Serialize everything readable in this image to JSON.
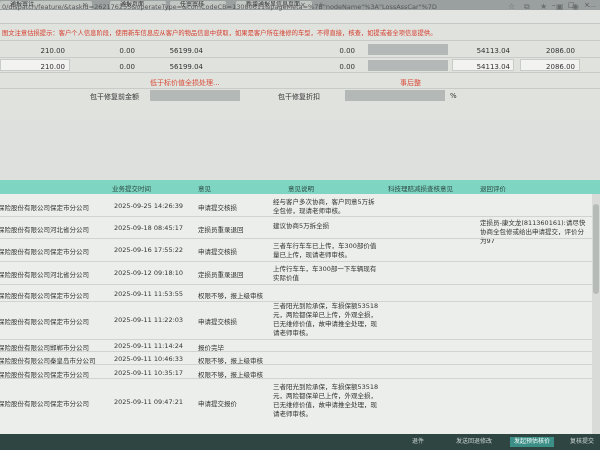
{
  "browser": {
    "tabs": [
      {
        "label": "通报审计"
      },
      {
        "label": "通报页面"
      },
      {
        "label": "任审审核"
      },
      {
        "label": "新增通报显信息页面"
      }
    ],
    "url": "0/dispatch/feature/&taskId=262176255&operateType=&comCodeCB=13080611&pageMeta=%7B\"nodeName\"%3A\"LossAssCar\"%7D"
  },
  "warning": "图文注意估损提示：客户个人信息阶段，使用新车信息应从客户的物品信息中获取，如果是客户所在维修的车型，不得直接，核查，如提或者全项信息提供。",
  "summary": {
    "row1": [
      "210.00",
      "0.00",
      "56199.04",
      "0.00",
      "54113.04",
      "2086.00"
    ],
    "row2": [
      "210.00",
      "0.00",
      "56199.04",
      "0.00",
      "54113.04",
      "2086.00"
    ],
    "link_left": "低于标价值全损处理...",
    "link_right": "事后整",
    "label_left": "包干修复前金额",
    "label_right": "包干修复折扣",
    "pct": "%"
  },
  "table": {
    "headers": [
      "业务提交时间",
      "意见",
      "意见说明",
      "科技理赔减损查核意见",
      "退回评价"
    ],
    "rows": [
      {
        "org": "保险股份有限公司保定市分公司",
        "time": "2025-09-25 14:26:39",
        "opinion": "申请提交核损",
        "note": [
          "经与客户多次协商，客户同意5万拆",
          "全包修，现请老师审核。"
        ],
        "review": ""
      },
      {
        "org": "保险股份有限公司河北省分公司",
        "time": "2025-09-18 08:45:17",
        "opinion": "定损员重录退回",
        "note": [
          "建议协商5万拆全损"
        ],
        "review": "定损员-康文龙(811360161):请尽快协商全包修或给出申请提交，评价分为97"
      },
      {
        "org": "保险股份有限公司保定市分公司",
        "time": "2025-09-16 17:55:22",
        "opinion": "申请提交核损",
        "note": [
          "三者车行车车已上传，车300部价值",
          "量已上传，现请老师审核。"
        ],
        "review": ""
      },
      {
        "org": "保险股份有限公司河北省分公司",
        "time": "2025-09-12 09:18:10",
        "opinion": "定损员重录退回",
        "note": [
          "上传行车车，车300部一下车辆现有",
          "实际价值"
        ],
        "review": ""
      },
      {
        "org": "保险股份有限公司保定市分公司",
        "time": "2025-09-11 11:53:55",
        "opinion": "权限不够，报上级审核",
        "note": [],
        "review": ""
      },
      {
        "org": "保险股份有限公司保定市分公司",
        "time": "2025-09-11 11:22:03",
        "opinion": "申请提交核损",
        "note": [
          "三者阳光到险承保，车损保额53518",
          "元，两险都保单已上传，外观全损，",
          "已无维修价值，故申请推全处理，现",
          "请老师审核。"
        ],
        "review": ""
      },
      {
        "org": "保险股份有限公司邯郸市分公司",
        "time": "2025-09-11 11:14:24",
        "opinion": "报价完毕",
        "note": [],
        "review": ""
      },
      {
        "org": "保险股份有限公司秦皇岛市分公司",
        "time": "2025-09-11 10:46:33",
        "opinion": "权限不够，报上级审核",
        "note": [],
        "review": ""
      },
      {
        "org": "保险股份有限公司保定市分公司",
        "time": "2025-09-11 10:35:17",
        "opinion": "权限不够，报上级审核",
        "note": [],
        "review": ""
      },
      {
        "org": "保险股份有限公司保定市分公司",
        "time": "2025-09-11 09:47:21",
        "opinion": "申请提交报价",
        "note": [
          "三者阳光到险承保，车损保额53518",
          "元，两险都保单已上传，外观全损，",
          "已无维修价值，故申请推全处理，现",
          "请老师审核。"
        ],
        "review": ""
      }
    ]
  },
  "footer": {
    "buttons": [
      "退件",
      "发送回退修改",
      "发起预估核价",
      "复核提交"
    ]
  }
}
